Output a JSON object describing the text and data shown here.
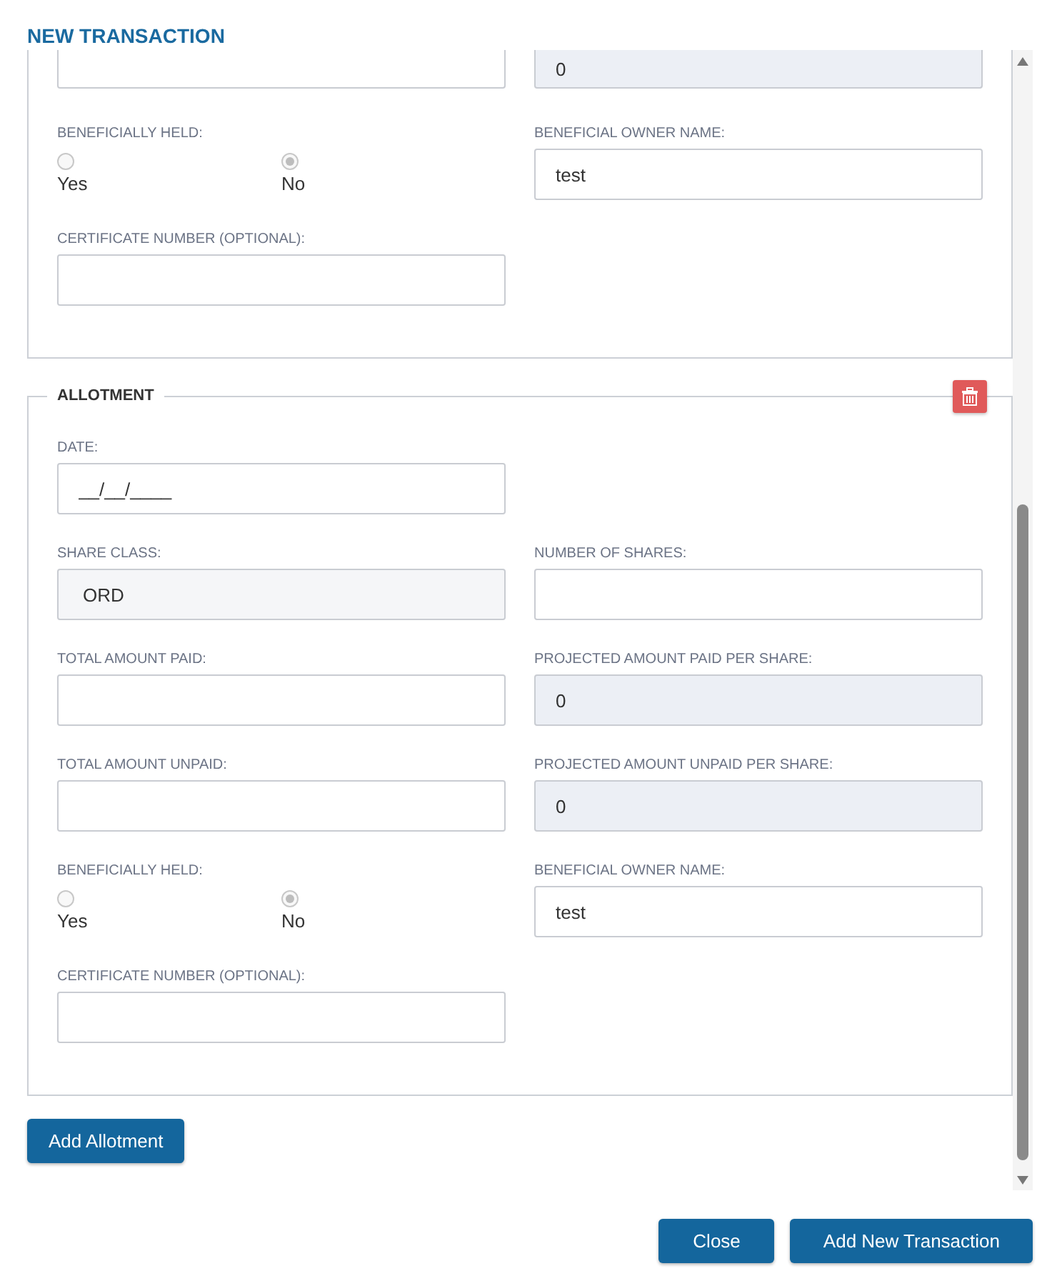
{
  "title": "NEW TRANSACTION",
  "sections": [
    {
      "rows": [
        [
          {
            "kind": "input"
          },
          {
            "kind": "computed",
            "value": "0"
          }
        ],
        [
          {
            "kind": "radio",
            "label": "BENEFICIALLY HELD:",
            "options": [
              {
                "label": "Yes",
                "selected": false
              },
              {
                "label": "No",
                "selected": true
              }
            ]
          },
          {
            "kind": "input",
            "label": "BENEFICIAL OWNER NAME:",
            "value": "test"
          }
        ],
        [
          {
            "kind": "input",
            "label": "CERTIFICATE NUMBER (OPTIONAL):"
          },
          {
            "kind": "empty"
          }
        ]
      ]
    },
    {
      "legend": "ALLOTMENT",
      "rows": [
        [
          {
            "kind": "input",
            "label": "DATE:",
            "value": "__/__/____"
          },
          {
            "kind": "empty"
          }
        ],
        [
          {
            "kind": "locked",
            "label": "SHARE CLASS:",
            "value": "ORD"
          },
          {
            "kind": "input",
            "label": "NUMBER OF SHARES:"
          }
        ],
        [
          {
            "kind": "input",
            "label": "TOTAL AMOUNT PAID:"
          },
          {
            "kind": "computed",
            "label": "PROJECTED AMOUNT PAID PER SHARE:",
            "value": "0"
          }
        ],
        [
          {
            "kind": "input",
            "label": "TOTAL AMOUNT UNPAID:"
          },
          {
            "kind": "computed",
            "label": "PROJECTED AMOUNT UNPAID PER SHARE:",
            "value": "0"
          }
        ],
        [
          {
            "kind": "radio",
            "label": "BENEFICIALLY HELD:",
            "options": [
              {
                "label": "Yes",
                "selected": false
              },
              {
                "label": "No",
                "selected": true
              }
            ]
          },
          {
            "kind": "input",
            "label": "BENEFICIAL OWNER NAME:",
            "value": "test"
          }
        ],
        [
          {
            "kind": "input",
            "label": "CERTIFICATE NUMBER (OPTIONAL):"
          },
          {
            "kind": "empty"
          }
        ]
      ]
    }
  ],
  "add_button": "Add Allotment",
  "footer_buttons": [
    "Close",
    "Add New Transaction"
  ]
}
